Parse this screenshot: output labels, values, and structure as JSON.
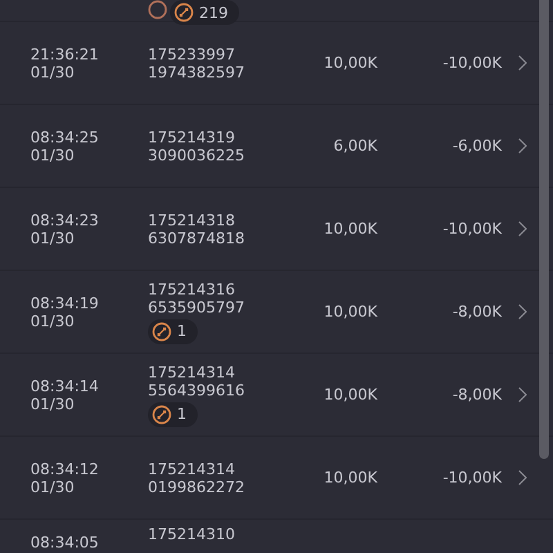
{
  "top_row": {
    "badge": {
      "count": "219"
    }
  },
  "rows": [
    {
      "time": "21:36:21",
      "date": "01/30",
      "id_1": "175233997",
      "id_2": "1974382597",
      "amount": "10,00K",
      "result": "-10,00K",
      "badge": null
    },
    {
      "time": "08:34:25",
      "date": "01/30",
      "id_1": "175214319",
      "id_2": "3090036225",
      "amount": "6,00K",
      "result": "-6,00K",
      "badge": null
    },
    {
      "time": "08:34:23",
      "date": "01/30",
      "id_1": "175214318",
      "id_2": "6307874818",
      "amount": "10,00K",
      "result": "-10,00K",
      "badge": null
    },
    {
      "time": "08:34:19",
      "date": "01/30",
      "id_1": "175214316",
      "id_2": "6535905797",
      "amount": "10,00K",
      "result": "-8,00K",
      "badge": {
        "count": "1"
      }
    },
    {
      "time": "08:34:14",
      "date": "01/30",
      "id_1": "175214314",
      "id_2": "5564399616",
      "amount": "10,00K",
      "result": "-8,00K",
      "badge": {
        "count": "1"
      }
    },
    {
      "time": "08:34:12",
      "date": "01/30",
      "id_1": "175214314",
      "id_2": "0199862272",
      "amount": "10,00K",
      "result": "-10,00K",
      "badge": null
    }
  ],
  "partial_row": {
    "time": "08:34:05",
    "id_1": "175214310"
  }
}
